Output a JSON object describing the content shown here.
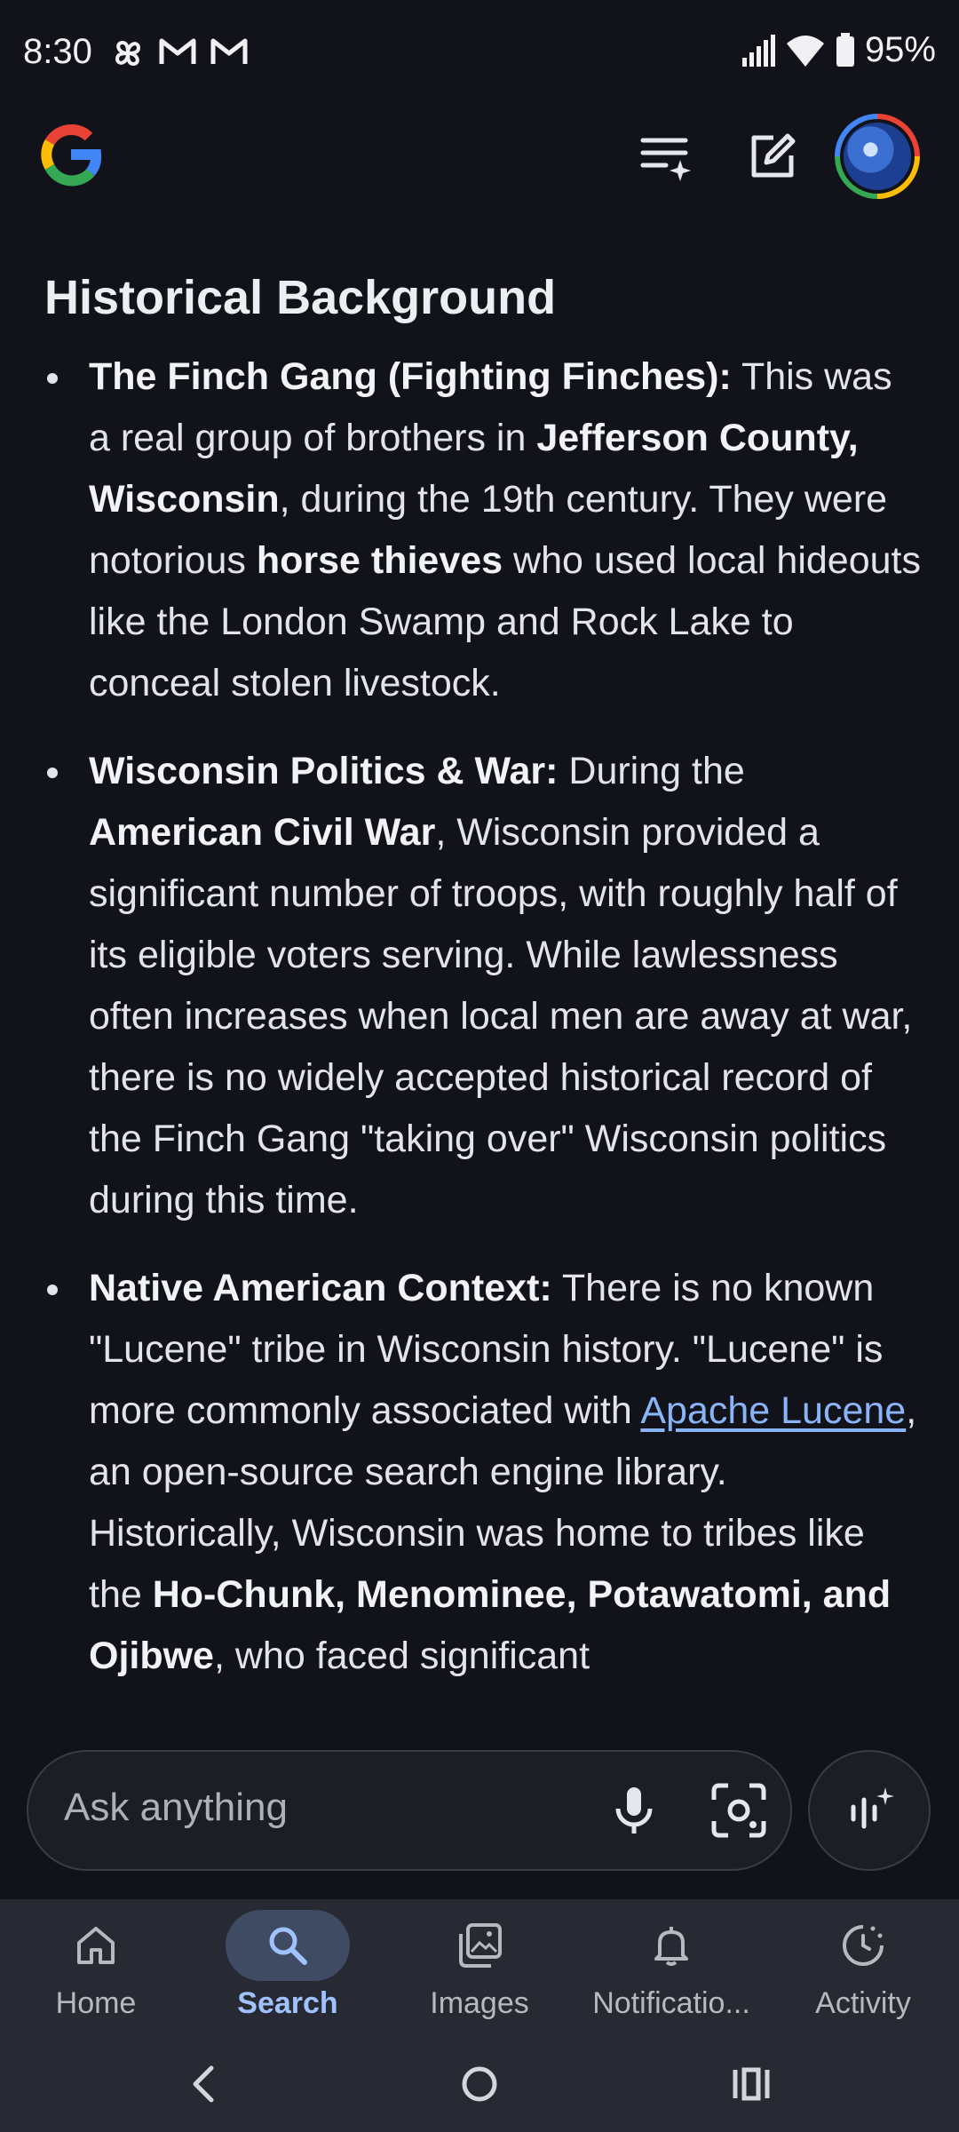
{
  "status_bar": {
    "time": "8:30",
    "battery": "95%"
  },
  "header": {
    "logo": "google-logo",
    "icons": [
      "history-icon",
      "new-chat-icon",
      "avatar"
    ]
  },
  "content": {
    "title": "Historical Background",
    "bullets": [
      {
        "heading": "The Finch Gang (Fighting Finches):",
        "t1": " This was a real group of brothers in ",
        "b1": "Jefferson County, Wisconsin",
        "t2": ", during the 19th century. They were notorious ",
        "b2": "horse thieves",
        "t3": " who used local hideouts like the London Swamp and Rock Lake to conceal stolen livestock."
      },
      {
        "heading": "Wisconsin Politics & War:",
        "t1": " During the ",
        "b1": "American Civil War",
        "t2": ", Wisconsin provided a significant number of troops, with roughly half of its eligible voters serving. While lawlessness often increases when local men are away at war, there is no widely accepted historical record of the Finch Gang \"taking over\" Wisconsin politics during this time."
      },
      {
        "heading": "Native American Context:",
        "t1": " There is no known \"Lucene\" tribe in Wisconsin history. \"Lucene\" is more commonly associated with ",
        "link": "Apache Lucene",
        "t2": ", an open-source search engine library. Historically, Wisconsin was home to tribes like the ",
        "b1": "Ho-Chunk, Menominee, Potawatomi, and Ojibwe",
        "t3": ", who faced significant"
      }
    ]
  },
  "ask": {
    "placeholder": "Ask anything"
  },
  "nav": {
    "items": [
      {
        "label": "Home",
        "icon": "home-icon"
      },
      {
        "label": "Search",
        "icon": "search-icon",
        "active": true
      },
      {
        "label": "Images",
        "icon": "images-icon"
      },
      {
        "label": "Notificatio...",
        "icon": "bell-icon"
      },
      {
        "label": "Activity",
        "icon": "activity-icon"
      }
    ]
  },
  "colors": {
    "background": "#12131a",
    "accent": "#8ab4f8",
    "nav_bg": "#272a33"
  }
}
